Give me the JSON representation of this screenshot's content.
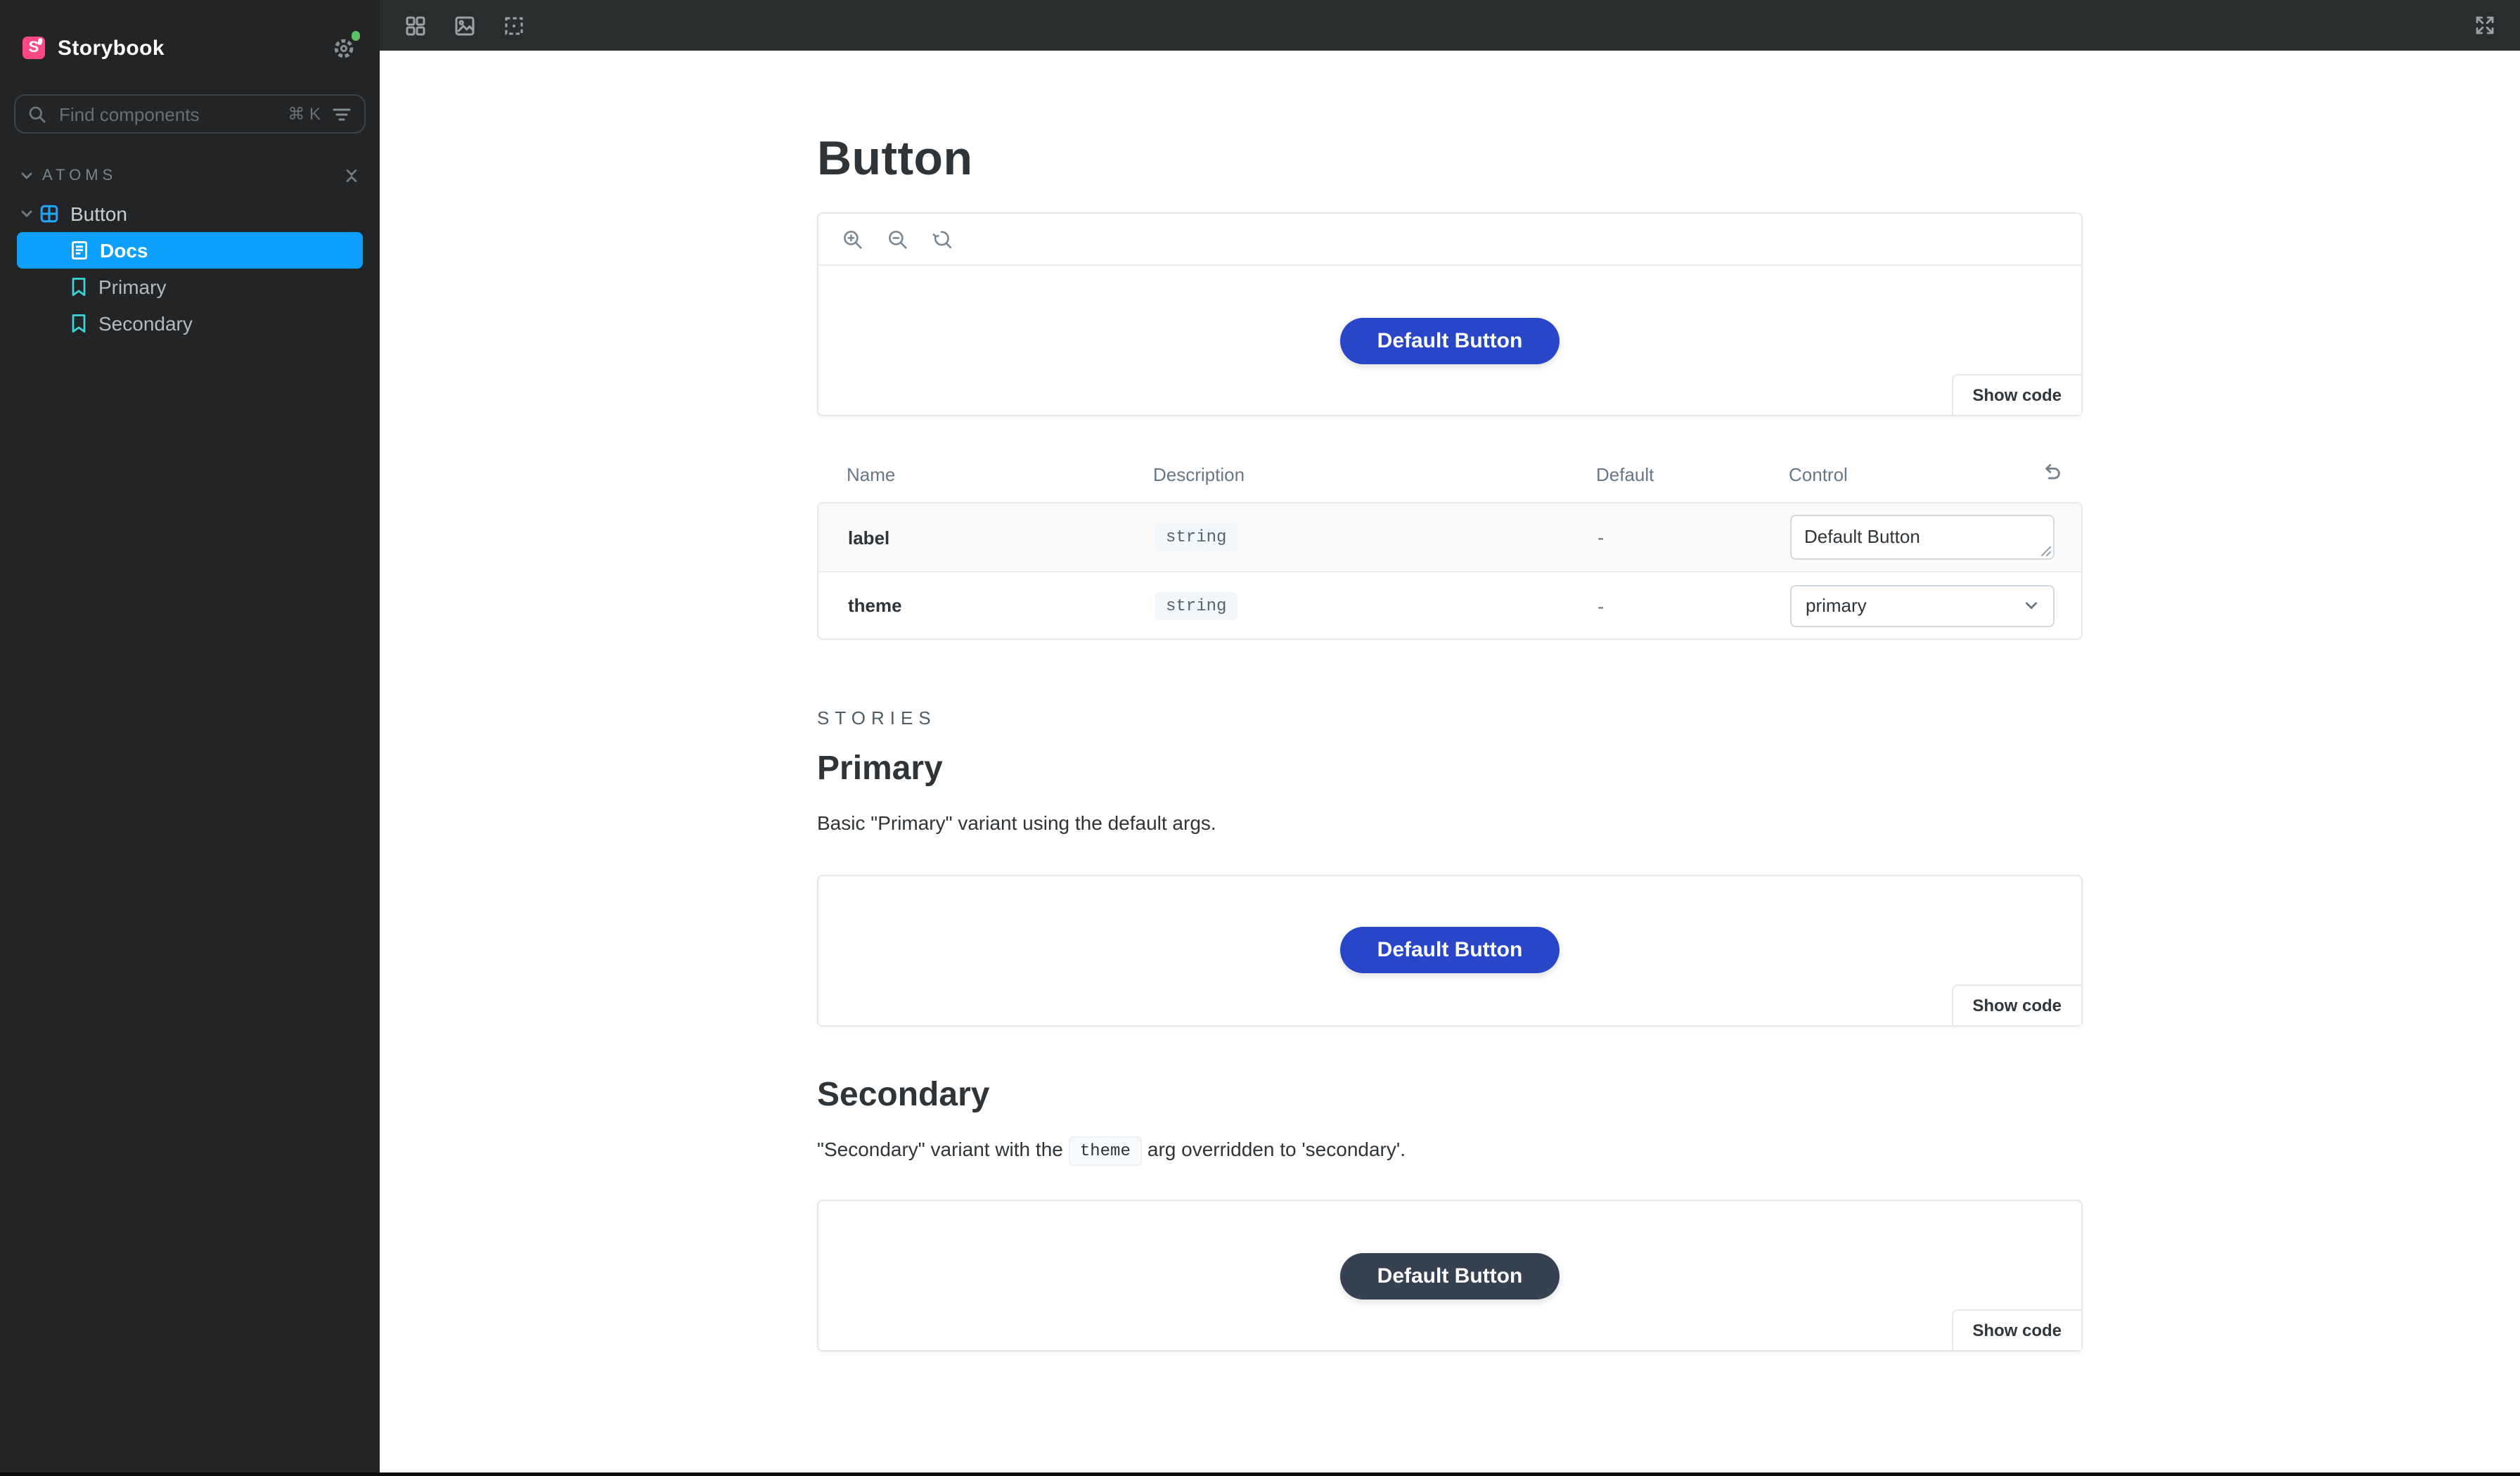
{
  "colors": {
    "sidebar_bg": "#222425",
    "toolbar_bg": "#2A2D2E",
    "selected_item": "#0CA0FA",
    "brand_pink": "#FF4785",
    "component_icon_blue": "#1EA7FD",
    "story_icon_teal": "#37D5D3",
    "status_dot_green": "#5AC264",
    "primary_button": "#2A46C8",
    "secondary_button": "#364252",
    "text_dark": "#2E3438"
  },
  "sidebar": {
    "brand": "Storybook",
    "search": {
      "placeholder": "Find components",
      "shortcut": "⌘ K"
    },
    "section": {
      "label": "ATOMS"
    },
    "tree": {
      "component": {
        "label": "Button"
      },
      "items": [
        {
          "label": "Docs",
          "selected": true
        },
        {
          "label": "Primary",
          "selected": false
        },
        {
          "label": "Secondary",
          "selected": false
        }
      ]
    }
  },
  "toolbar": {
    "icons": [
      "grid-icon",
      "image-icon",
      "outline-icon",
      "fullscreen-icon"
    ]
  },
  "doc": {
    "title": "Button",
    "show_code_label": "Show code",
    "preview_button_label": "Default Button",
    "args_table": {
      "headers": [
        "Name",
        "Description",
        "Default",
        "Control"
      ],
      "rows": [
        {
          "name": "label",
          "description": "string",
          "default": "-",
          "control": {
            "type": "text",
            "value": "Default Button"
          }
        },
        {
          "name": "theme",
          "description": "string",
          "default": "-",
          "control": {
            "type": "select",
            "value": "primary"
          }
        }
      ]
    },
    "stories_label": "STORIES",
    "stories": [
      {
        "title": "Primary",
        "description": "Basic \"Primary\" variant using the default args.",
        "button_label": "Default Button",
        "variant": "primary"
      },
      {
        "title": "Secondary",
        "description_before": "\"Secondary\" variant with the",
        "description_code": "theme",
        "description_after": "arg overridden to 'secondary'.",
        "button_label": "Default Button",
        "variant": "secondary"
      }
    ]
  }
}
